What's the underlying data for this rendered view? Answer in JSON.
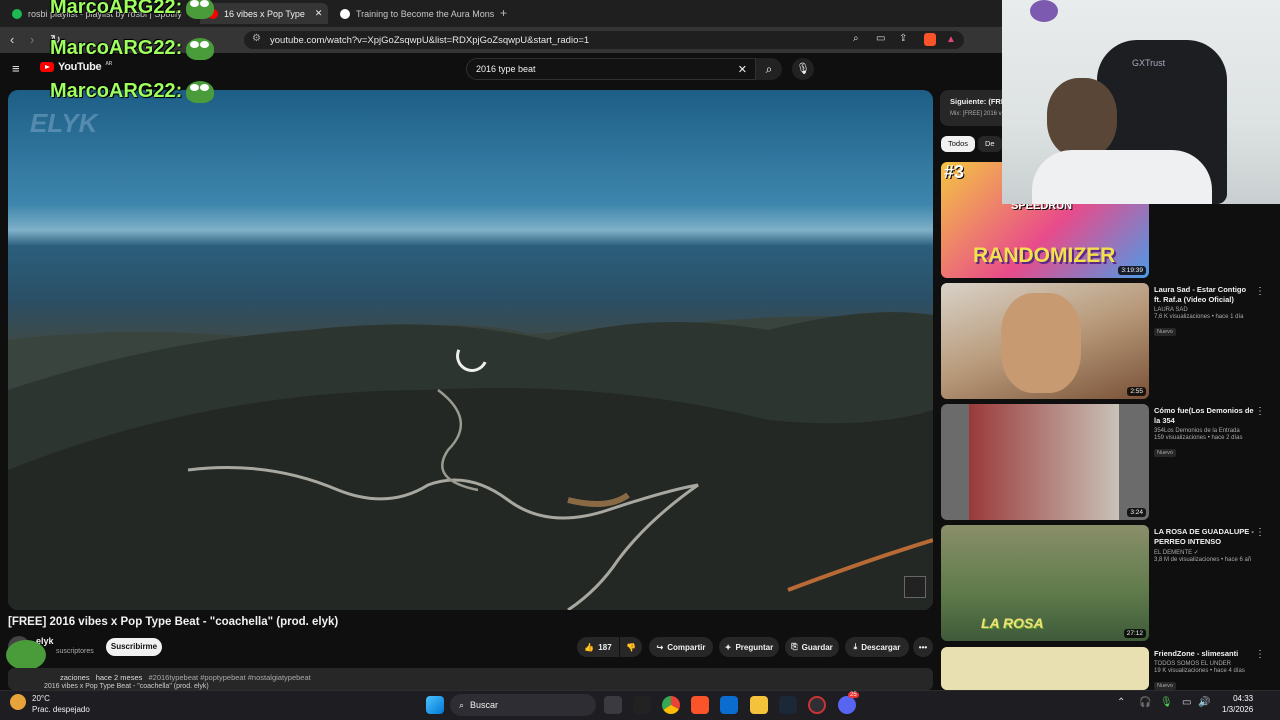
{
  "browser": {
    "tabs": [
      {
        "label": "rosbi playlist - playlist by rosbi | Spotify",
        "favicon_color": "#1db954"
      },
      {
        "label": "16 vibes x Pop Type",
        "favicon_color": "#ff0000"
      },
      {
        "label": "Training to Become the Aura Monster",
        "favicon_color": "#ffffff"
      }
    ],
    "new_tab": "+",
    "url": "youtube.com/watch?v=XpjGoZsqwpU&list=RDXpjGoZsqwpU&start_radio=1"
  },
  "youtube": {
    "logo_text": "YouTube",
    "logo_sup": "AR",
    "search_value": "2016 type beat",
    "clear_glyph": "✕",
    "search_glyph": "⌕",
    "mic_glyph": "🎙"
  },
  "video": {
    "watermark": "ELYK",
    "title": "[FREE] 2016 vibes x Pop Type Beat - \"coachella\" (prod. elyk)",
    "channel": "elyk",
    "subscribers": "suscriptores",
    "subscribe_label": "Suscribirme",
    "likes": "187",
    "share_label": "Compartir",
    "ask_label": "Preguntar",
    "save_label": "Guardar",
    "download_label": "Descargar",
    "more_glyph": "•••",
    "description_views": "zaciones",
    "description_age": "hace 2 meses",
    "description_tags": "#2016typebeat #poptypebeat #nostalgiatypebeat",
    "description_line2": "2016 vibes x Pop Type Beat - \"coachella\" (prod. elyk)"
  },
  "chat_overlay": [
    {
      "text": "MarcoARG22:"
    },
    {
      "text": "MarcoARG22:"
    },
    {
      "text": "MarcoARG22:"
    }
  ],
  "overlay_badge": "X5",
  "sidebar": {
    "next_label": "Siguiente: (FRE",
    "next_sub": "Mix: [FREE] 2016 vi",
    "chips": [
      "Todos",
      "De tu"
    ],
    "videos": [
      {
        "title": "",
        "channel": "",
        "meta": "",
        "badge": "",
        "duration": "3:19:39",
        "thumb_text": "RANDOMIZER",
        "thumb_top": "SPEEDRUN",
        "thumb_num": "#3"
      },
      {
        "title": "Laura Sad - Estar Contigo ft. Raf.a (Video Oficial)",
        "channel": "LAURA SAD",
        "meta": "7,6 K visualizaciones • hace 1 día",
        "badge": "Nuevo",
        "duration": "2:55"
      },
      {
        "title": "Cómo fue(Los Demonios de la 354",
        "channel": "354Los Demonios de la Entrada",
        "meta": "159 visualizaciones • hace 2 días",
        "badge": "Nuevo",
        "duration": "3:24"
      },
      {
        "title": "LA ROSA DE GUADALUPE - PERREO INTENSO",
        "channel": "EL DEMENTE ✓",
        "meta": "3,8 M de visualizaciones • hace 6 añ",
        "badge": "",
        "duration": "27:12",
        "thumb_text": "LA ROSA"
      },
      {
        "title": "FriendZone - slimesanti",
        "channel": "TODOS SOMOS EL UNDER",
        "meta": "19 K visualizaciones • hace 4 días",
        "badge": "Nuevo",
        "duration": ""
      }
    ]
  },
  "webcam": {
    "chair_brand": "GXTrust"
  },
  "taskbar": {
    "weather_temp": "20°C",
    "weather_desc": "Prac. despejado",
    "search_label": "Buscar",
    "time": "04:33",
    "date": "1/3/2026",
    "discord_badge": "25"
  },
  "colors": {
    "accent": "#ff0000",
    "background": "#0f0f0f",
    "chip_active": "#f1f1f1",
    "chat_green": "#9fff5e"
  }
}
